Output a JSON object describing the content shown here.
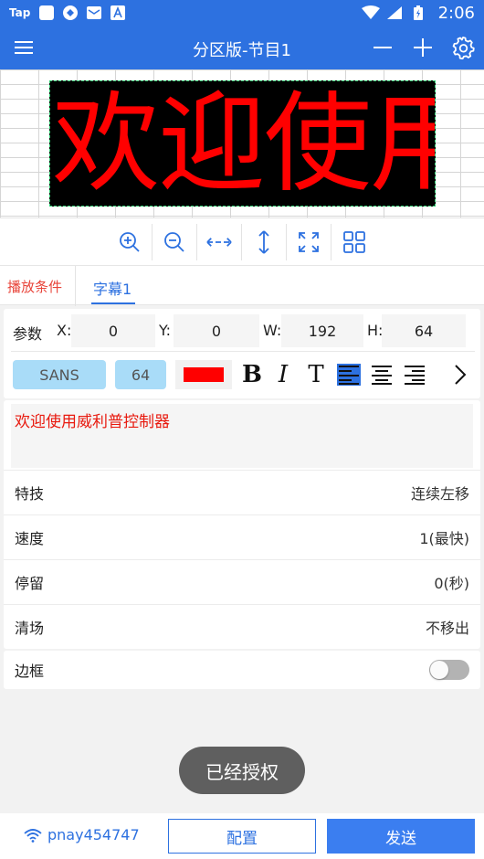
{
  "status_bar": {
    "app_label": "Tap",
    "time": "2:06"
  },
  "app_bar": {
    "title": "分区版-节目1"
  },
  "led_preview": {
    "text": "欢迎使用",
    "text_color": "#ff0000",
    "bg_color": "#000000"
  },
  "tabs": {
    "play_condition": "播放条件",
    "subtitle": "字幕1"
  },
  "params": {
    "label": "参数",
    "x_label": "X:",
    "x": "0",
    "y_label": "Y:",
    "y": "0",
    "w_label": "W:",
    "w": "192",
    "h_label": "H:",
    "h": "64"
  },
  "font": {
    "family": "SANS",
    "size": "64",
    "color": "#ff0000"
  },
  "format": {
    "bold": "B",
    "italic": "I",
    "text": "T"
  },
  "text_content": "欢迎使用威利普控制器",
  "rows": [
    {
      "label": "特技",
      "value": "连续左移"
    },
    {
      "label": "速度",
      "value": "1(最快)"
    },
    {
      "label": "停留",
      "value": "0(秒)"
    },
    {
      "label": "清场",
      "value": "不移出"
    }
  ],
  "border": {
    "label": "边框",
    "enabled": false
  },
  "toast": "已经授权",
  "bottom": {
    "wifi_name": "pnay454747",
    "config_label": "配置",
    "send_label": "发送"
  },
  "colors": {
    "primary": "#2d71e0",
    "accent_red": "#e8443a"
  }
}
